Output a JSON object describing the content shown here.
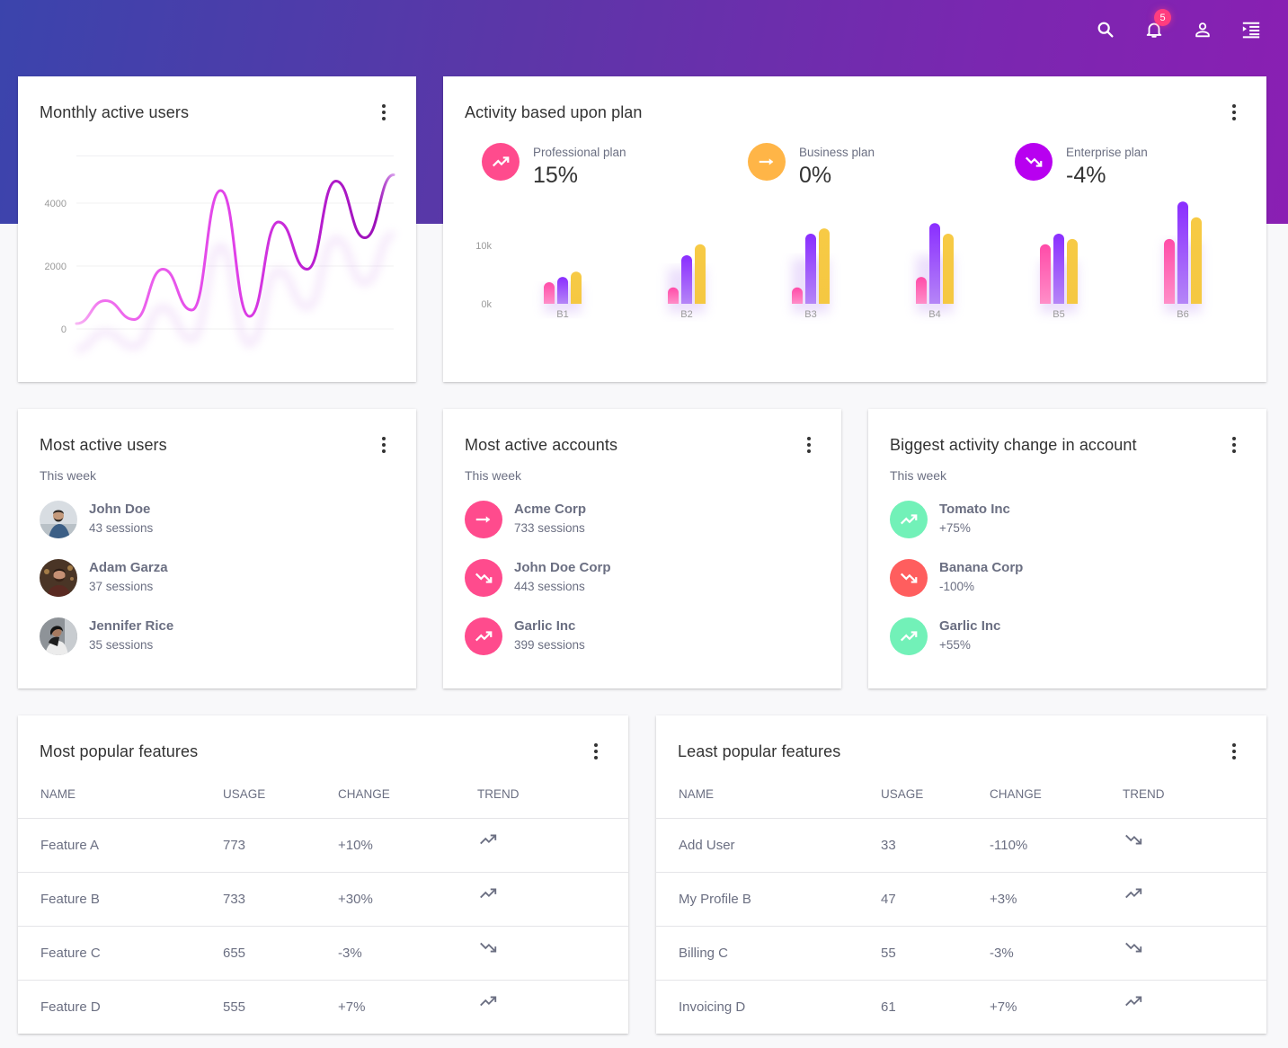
{
  "header": {
    "notification_count": "5",
    "icons": [
      "search-icon",
      "bell-icon",
      "user-icon",
      "menu-indent-icon"
    ]
  },
  "colors": {
    "pink": "#ff4b8d",
    "orange": "#ffb547",
    "purple": "#b800f0",
    "violet": "#8a2eff",
    "yellow": "#f7ca45",
    "green": "#72f1b8",
    "red": "#ff5e5e"
  },
  "monthly_active_users": {
    "title": "Monthly active users",
    "chart_data": {
      "type": "line",
      "title": "Monthly active users",
      "xlabel": "",
      "ylabel": "",
      "ylim": [
        -500,
        5800
      ],
      "yticks": [
        0,
        2000,
        4000
      ],
      "ytick_labels": [
        "0",
        "2000",
        "4000"
      ],
      "grid": true,
      "values": [
        170,
        900,
        300,
        1900,
        600,
        4400,
        400,
        3400,
        1900,
        4700,
        2900,
        4900
      ]
    }
  },
  "activity_plan": {
    "title": "Activity based upon plan",
    "plans": [
      {
        "label": "Professional plan",
        "value": "15%",
        "icon": "trending-up-icon",
        "color": "#ff4b8d"
      },
      {
        "label": "Business plan",
        "value": "0%",
        "icon": "arrow-right-icon",
        "color": "#ffb547"
      },
      {
        "label": "Enterprise plan",
        "value": "-4%",
        "icon": "trending-down-icon",
        "color": "#b800f0"
      }
    ],
    "chart_data": {
      "type": "bar",
      "title": "",
      "categories": [
        "B1",
        "B2",
        "B3",
        "B4",
        "B5",
        "B6"
      ],
      "yticks": [
        0,
        10000
      ],
      "ytick_labels": [
        "0k",
        "10k"
      ],
      "ylim": [
        0,
        18000
      ],
      "series": [
        {
          "name": "Professional",
          "color": "#ff4b8d",
          "values": [
            3700,
            2800,
            2800,
            4600,
            10200,
            11100
          ]
        },
        {
          "name": "Business",
          "color": "#8a2eff",
          "values": [
            4600,
            8300,
            12000,
            13800,
            12000,
            17500
          ]
        },
        {
          "name": "Enterprise",
          "color": "#f7ca45",
          "values": [
            5500,
            10200,
            12900,
            12000,
            11100,
            14800
          ]
        }
      ]
    }
  },
  "most_active_users": {
    "title": "Most active users",
    "subtitle": "This week",
    "items": [
      {
        "name": "John Doe",
        "sub": "43 sessions"
      },
      {
        "name": "Adam Garza",
        "sub": "37 sessions"
      },
      {
        "name": "Jennifer Rice",
        "sub": "35 sessions"
      }
    ]
  },
  "most_active_accounts": {
    "title": "Most active accounts",
    "subtitle": "This week",
    "items": [
      {
        "name": "Acme Corp",
        "sub": "733 sessions",
        "icon": "arrow-right-icon",
        "color": "#ff4b8d"
      },
      {
        "name": "John Doe Corp",
        "sub": "443 sessions",
        "icon": "trending-down-icon",
        "color": "#ff4b8d"
      },
      {
        "name": "Garlic Inc",
        "sub": "399 sessions",
        "icon": "trending-up-icon",
        "color": "#ff4b8d"
      }
    ]
  },
  "biggest_change": {
    "title": "Biggest activity change in account",
    "subtitle": "This week",
    "items": [
      {
        "name": "Tomato Inc",
        "sub": "+75%",
        "icon": "trending-up-icon",
        "color": "#72f1b8"
      },
      {
        "name": "Banana Corp",
        "sub": "-100%",
        "icon": "trending-down-icon",
        "color": "#ff5e5e"
      },
      {
        "name": "Garlic Inc",
        "sub": "+55%",
        "icon": "trending-up-icon",
        "color": "#72f1b8"
      }
    ]
  },
  "most_popular": {
    "title": "Most popular features",
    "columns": [
      "NAME",
      "USAGE",
      "CHANGE",
      "TREND"
    ],
    "rows": [
      {
        "name": "Feature A",
        "usage": "773",
        "change": "+10%",
        "trend": "up"
      },
      {
        "name": "Feature B",
        "usage": "733",
        "change": "+30%",
        "trend": "up"
      },
      {
        "name": "Feature C",
        "usage": "655",
        "change": "-3%",
        "trend": "down"
      },
      {
        "name": "Feature D",
        "usage": "555",
        "change": "+7%",
        "trend": "up"
      }
    ]
  },
  "least_popular": {
    "title": "Least popular features",
    "columns": [
      "NAME",
      "USAGE",
      "CHANGE",
      "TREND"
    ],
    "rows": [
      {
        "name": "Add User",
        "usage": "33",
        "change": "-110%",
        "trend": "down"
      },
      {
        "name": "My Profile B",
        "usage": "47",
        "change": "+3%",
        "trend": "up"
      },
      {
        "name": "Billing C",
        "usage": "55",
        "change": "-3%",
        "trend": "down"
      },
      {
        "name": "Invoicing D",
        "usage": "61",
        "change": "+7%",
        "trend": "up"
      }
    ]
  }
}
